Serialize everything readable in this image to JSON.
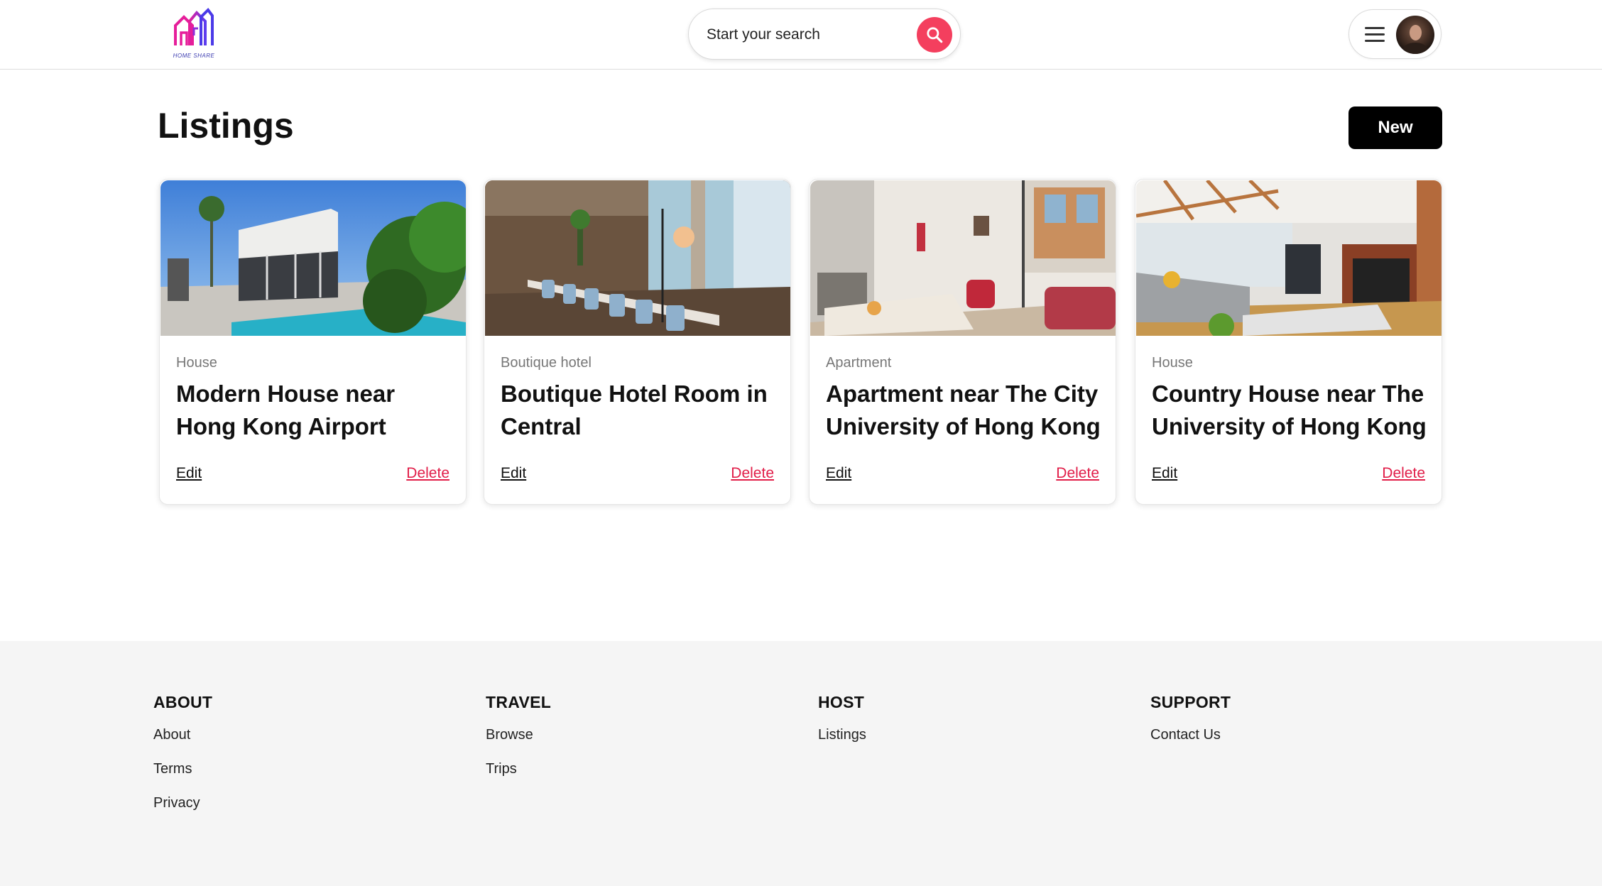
{
  "header": {
    "logo_text": "HOME SHARE",
    "search_label": "Start your search"
  },
  "page": {
    "title": "Listings",
    "new_button": "New"
  },
  "listings": [
    {
      "type": "House",
      "title": "Modern House near Hong Kong Airport",
      "edit": "Edit",
      "delete": "Delete"
    },
    {
      "type": "Boutique hotel",
      "title": "Boutique Hotel Room in Central",
      "edit": "Edit",
      "delete": "Delete"
    },
    {
      "type": "Apartment",
      "title": "Apartment near The City University of Hong Kong",
      "edit": "Edit",
      "delete": "Delete"
    },
    {
      "type": "House",
      "title": "Country House near The University of Hong Kong",
      "edit": "Edit",
      "delete": "Delete"
    }
  ],
  "footer": {
    "columns": [
      {
        "heading": "ABOUT",
        "links": [
          "About",
          "Terms",
          "Privacy"
        ]
      },
      {
        "heading": "TRAVEL",
        "links": [
          "Browse",
          "Trips"
        ]
      },
      {
        "heading": "HOST",
        "links": [
          "Listings"
        ]
      },
      {
        "heading": "SUPPORT",
        "links": [
          "Contact Us"
        ]
      }
    ]
  },
  "colors": {
    "accent": "#f43f5e",
    "delete": "#e11d48",
    "primary_button": "#000000",
    "footer_bg": "#f5f5f5"
  },
  "icons": [
    "home-share-logo",
    "search-icon",
    "menu-icon",
    "avatar"
  ]
}
